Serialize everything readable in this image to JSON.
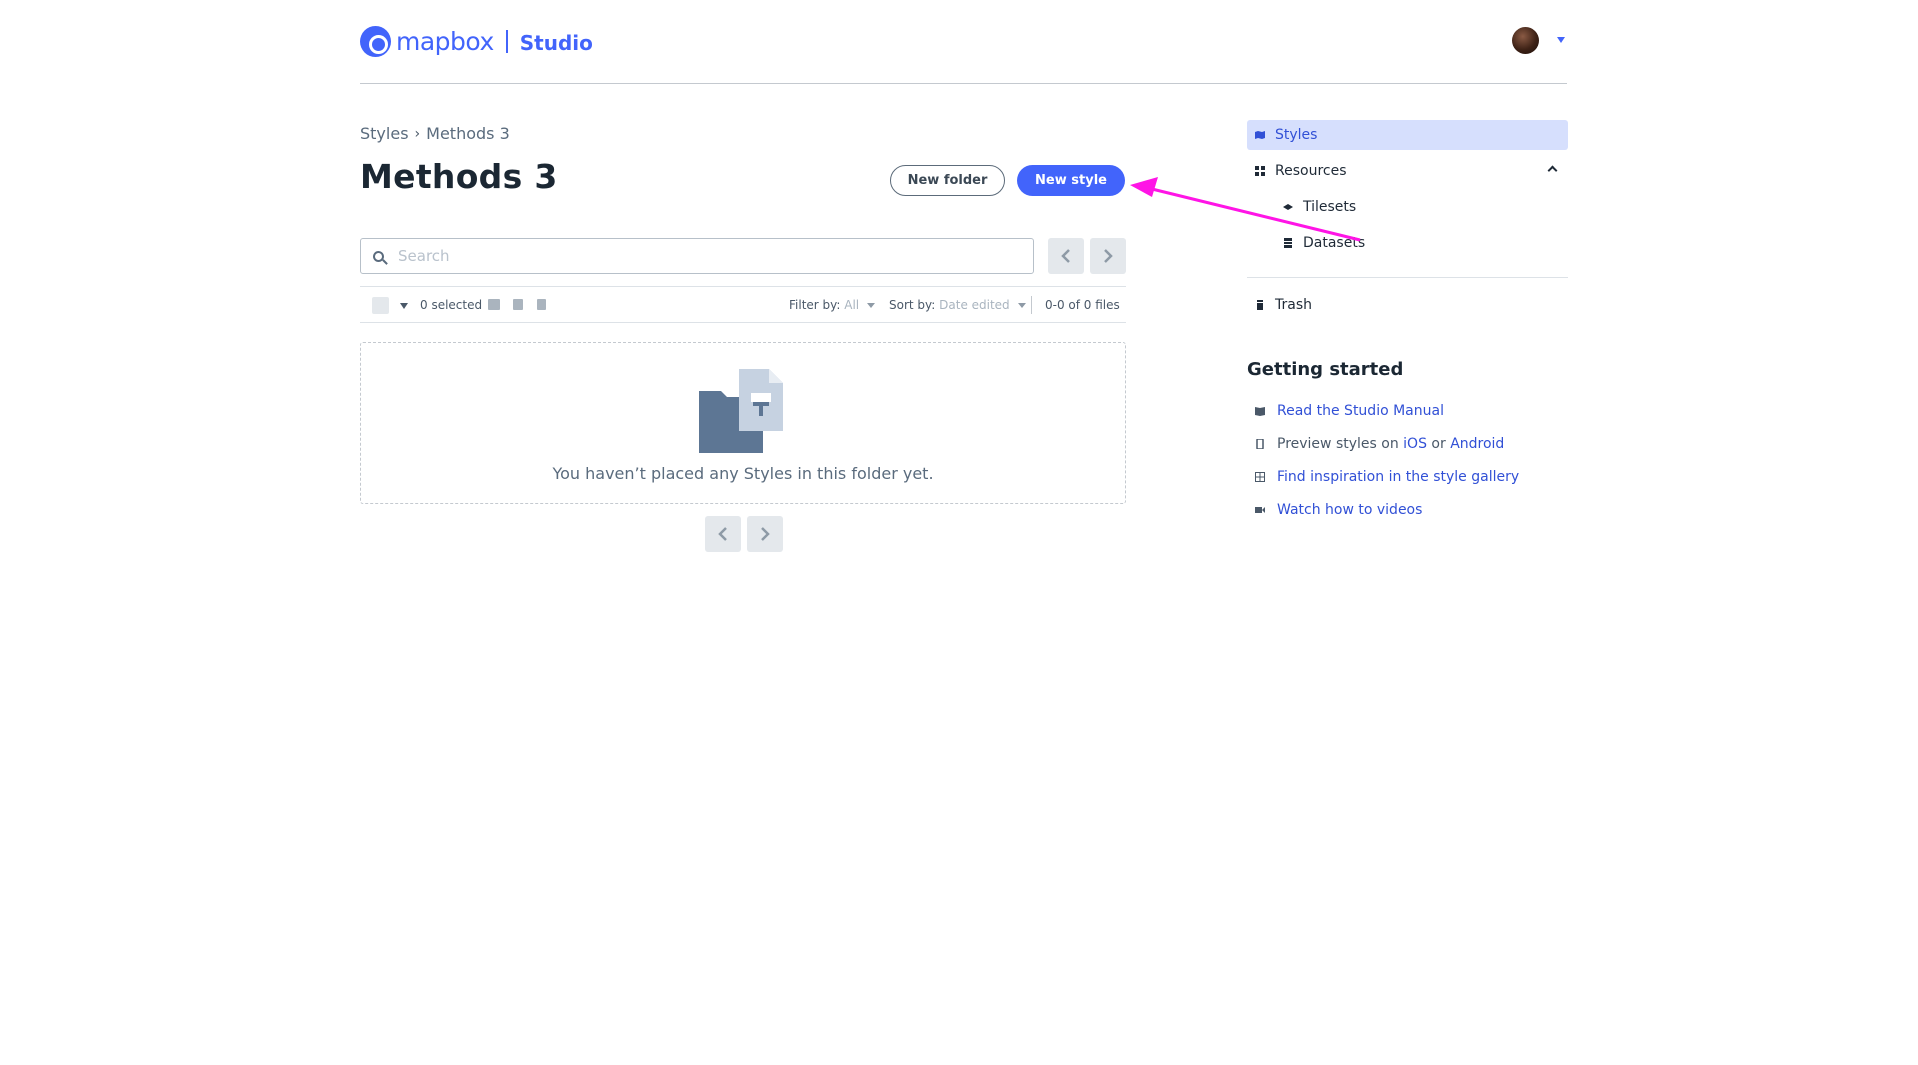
{
  "header": {
    "brand": "mapbox",
    "product": "Studio",
    "avatar_icon": "user-avatar"
  },
  "breadcrumb": {
    "items": [
      "Styles",
      "Methods 3"
    ],
    "separator": "›"
  },
  "page": {
    "title": "Methods 3"
  },
  "actions": {
    "new_folder_label": "New folder",
    "new_style_label": "New style"
  },
  "search": {
    "placeholder": "Search"
  },
  "toolbar": {
    "selected": "0 selected",
    "filter_label": "Filter by:",
    "filter_value": "All",
    "sort_label": "Sort by:",
    "sort_value": "Date edited",
    "count": "0-0 of 0 files"
  },
  "empty_state": {
    "message": "You haven’t placed any Styles in this folder yet."
  },
  "sidebar": {
    "items": [
      {
        "label": "Styles",
        "icon": "map-icon"
      },
      {
        "label": "Resources",
        "icon": "grid-icon"
      },
      {
        "label": "Tilesets",
        "icon": "layers-icon"
      },
      {
        "label": "Datasets",
        "icon": "database-icon"
      },
      {
        "label": "Trash",
        "icon": "trash-icon"
      }
    ]
  },
  "getting_started": {
    "title": "Getting started",
    "manual_link": "Read the Studio Manual",
    "preview_prefix": "Preview styles on",
    "ios": "iOS",
    "or": "or",
    "android": "Android",
    "gallery_link": "Find inspiration in the style gallery",
    "videos_link": "Watch how to videos"
  },
  "colors": {
    "brand": "#4264fb",
    "annotation": "#ff14e6"
  }
}
